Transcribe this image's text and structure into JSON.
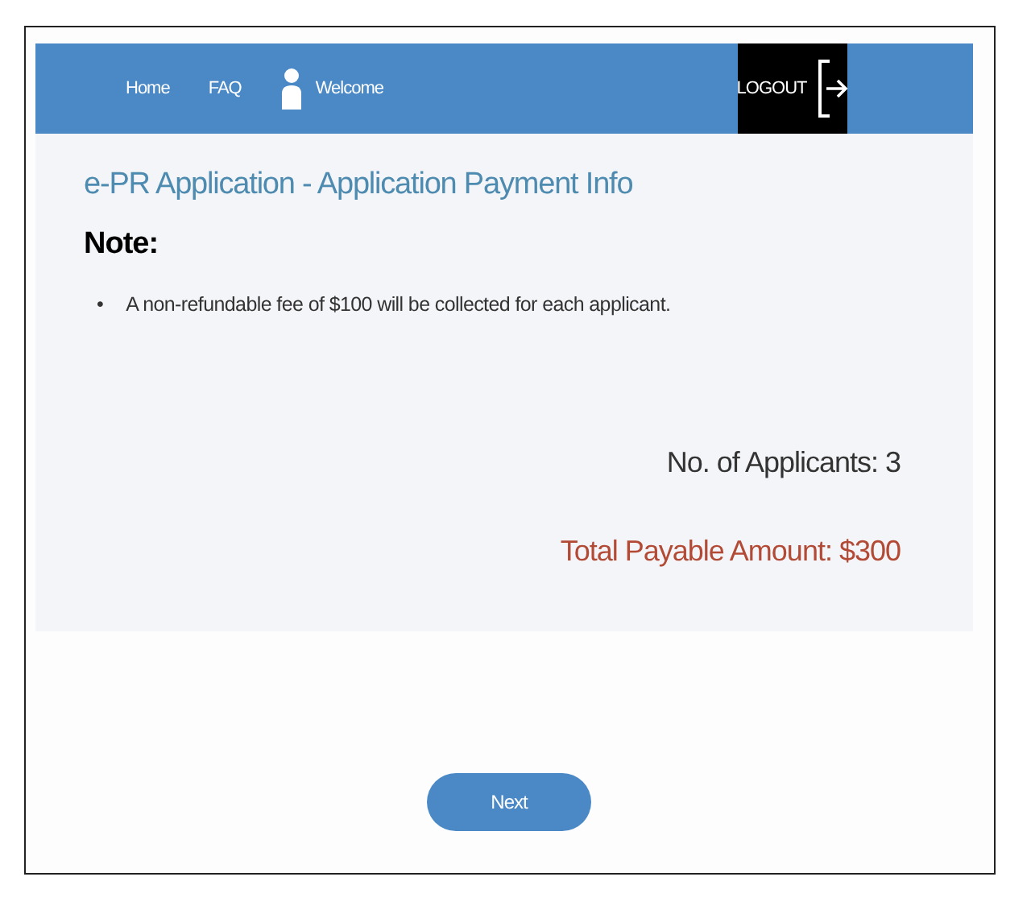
{
  "nav": {
    "links": [
      "Home",
      "FAQ"
    ],
    "user": "Welcome",
    "logout": "LOGOUT"
  },
  "page": {
    "title": "e-PR Application - Application Payment Info",
    "note_heading": "Note:",
    "notes": [
      {
        "marker": "•",
        "text": "A non-refundable fee of $100 will be collected for each applicant."
      }
    ],
    "applicants": "No. of Applicants: 3",
    "total": "Total Payable Amount: $300"
  },
  "buttons": [
    "Next"
  ]
}
